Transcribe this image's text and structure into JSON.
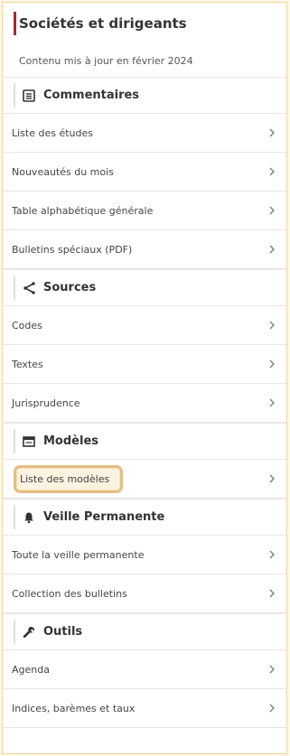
{
  "header": {
    "title": "Sociétés et dirigeants",
    "subtitle": "Contenu mis à jour en février 2024"
  },
  "sections": [
    {
      "title": "Commentaires",
      "icon": "list-icon",
      "items": [
        {
          "label": "Liste des études"
        },
        {
          "label": "Nouveautés du mois"
        },
        {
          "label": "Table alphabétique générale"
        },
        {
          "label": "Bulletins spéciaux (PDF)"
        }
      ]
    },
    {
      "title": "Sources",
      "icon": "share-icon",
      "items": [
        {
          "label": "Codes"
        },
        {
          "label": "Textes"
        },
        {
          "label": "Jurisprudence"
        }
      ]
    },
    {
      "title": "Modèles",
      "icon": "window-icon",
      "items": [
        {
          "label": "Liste des modèles",
          "highlighted": true
        }
      ]
    },
    {
      "title": "Veille Permanente",
      "icon": "bell-icon",
      "items": [
        {
          "label": "Toute la veille permanente"
        },
        {
          "label": "Collection des bulletins"
        }
      ]
    },
    {
      "title": "Outils",
      "icon": "wrench-icon",
      "items": [
        {
          "label": "Agenda"
        },
        {
          "label": "Indices, barèmes et taux"
        }
      ]
    }
  ],
  "colors": {
    "accent": "#a32c2a",
    "highlight_border": "#e3bf86",
    "page_background": "#fff8e6"
  }
}
